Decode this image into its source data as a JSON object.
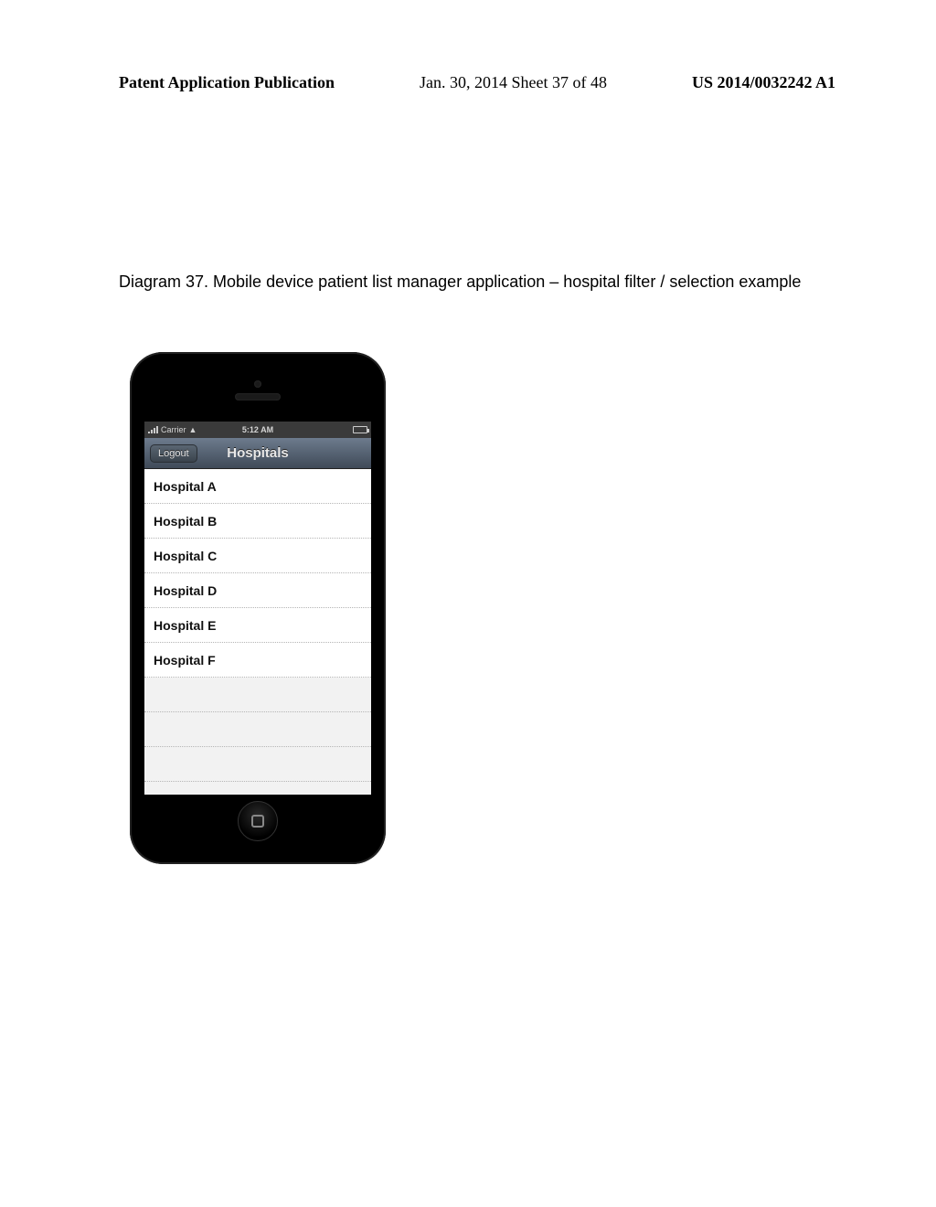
{
  "header": {
    "left": "Patent Application Publication",
    "middle": "Jan. 30, 2014  Sheet 37 of 48",
    "right": "US 2014/0032242 A1"
  },
  "caption": "Diagram 37.  Mobile device patient list manager application – hospital filter / selection example",
  "statusBar": {
    "carrier": "Carrier",
    "time": "5:12 AM"
  },
  "navBar": {
    "backLabel": "Logout",
    "title": "Hospitals"
  },
  "hospitals": [
    {
      "name": "Hospital A"
    },
    {
      "name": "Hospital B"
    },
    {
      "name": "Hospital C"
    },
    {
      "name": "Hospital D"
    },
    {
      "name": "Hospital E"
    },
    {
      "name": "Hospital F"
    }
  ]
}
